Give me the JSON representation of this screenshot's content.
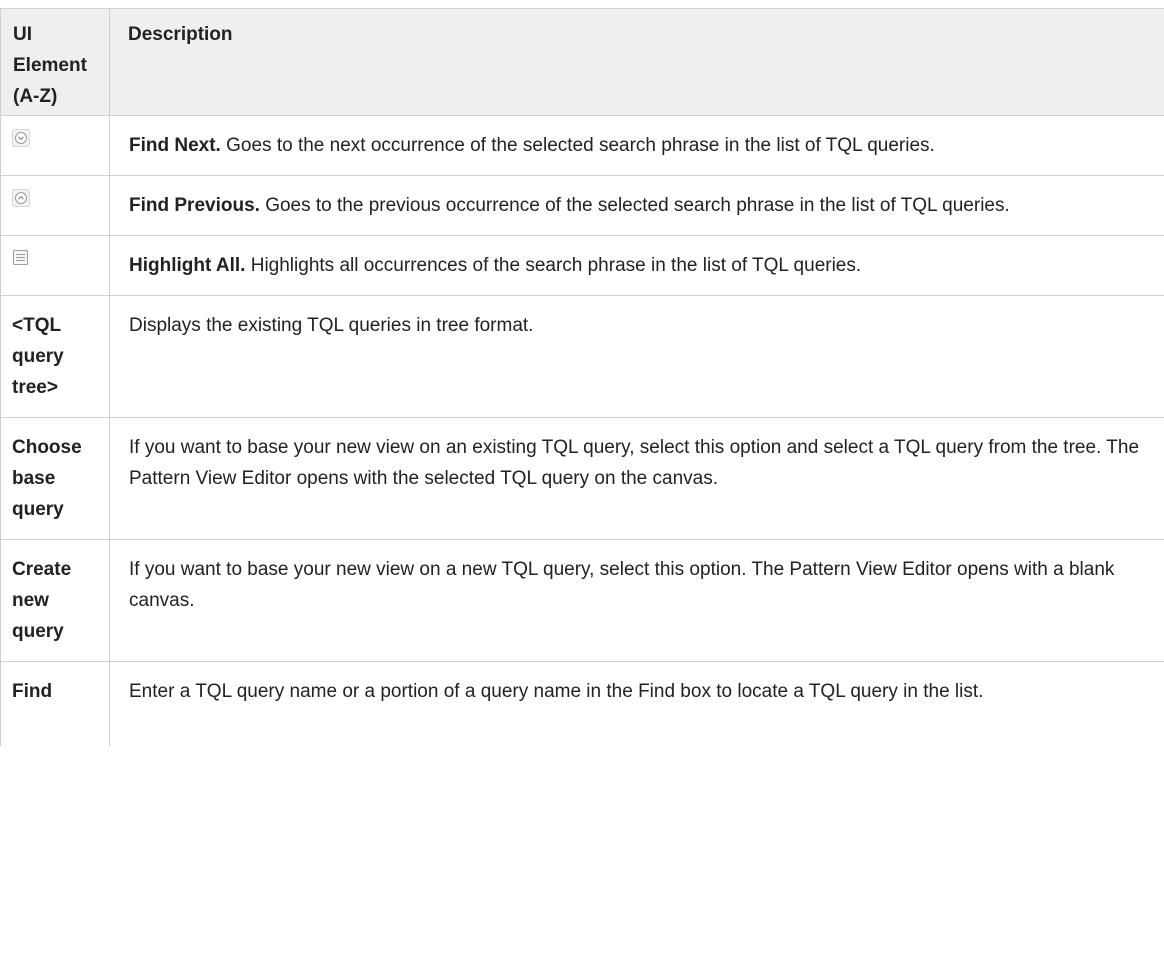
{
  "table": {
    "headers": [
      "UI Element (A-Z)",
      "Description"
    ],
    "rows": [
      {
        "element": "",
        "icon": "find-next-icon",
        "term": "Find Next.",
        "text": " Goes to the next occurrence of the selected search phrase in the list of TQL queries."
      },
      {
        "element": "",
        "icon": "find-previous-icon",
        "term": "Find Previous.",
        "text": " Goes to the previous occurrence of the selected search phrase in the list of TQL queries."
      },
      {
        "element": "",
        "icon": "highlight-all-icon",
        "term": "Highlight All.",
        "text": " Highlights all occurrences of the search phrase in the list of TQL queries."
      },
      {
        "element": "<TQL query tree>",
        "term": "",
        "text": "Displays the existing TQL queries in tree format."
      },
      {
        "element": "Choose base query",
        "term": "",
        "text": "If you want to base your new view on an existing TQL query, select this option and select a TQL query from the tree. The Pattern View Editor opens with the selected TQL query on the canvas."
      },
      {
        "element": "Create new query",
        "term": "",
        "text": "If you want to base your new view on a new TQL query, select this option. The Pattern View Editor opens with a blank canvas."
      },
      {
        "element": "Find",
        "term": "",
        "text": "Enter a TQL query name or a portion of a query name in the Find box to locate a TQL query in the list."
      }
    ]
  }
}
